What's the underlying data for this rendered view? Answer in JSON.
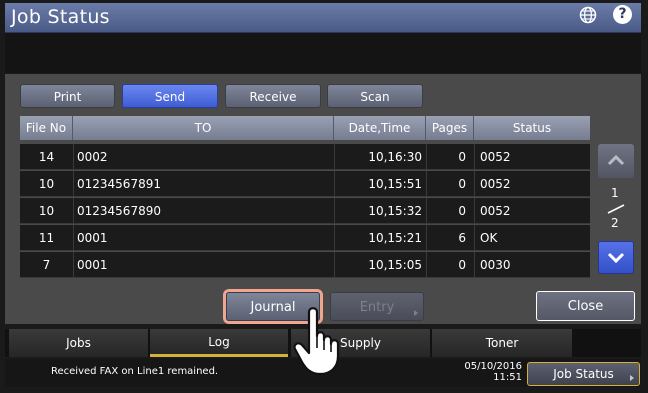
{
  "app": {
    "title": "Job Status"
  },
  "header": {
    "globe_icon": "globe-icon",
    "help_icon": "help-icon",
    "help_glyph": "?"
  },
  "tabs": [
    {
      "label": "Print",
      "active": false
    },
    {
      "label": "Send",
      "active": true
    },
    {
      "label": "Receive",
      "active": false
    },
    {
      "label": "Scan",
      "active": false
    }
  ],
  "table": {
    "columns": [
      "File No",
      "TO",
      "Date,Time",
      "Pages",
      "Status"
    ],
    "rows": [
      {
        "file_no": "14",
        "to": "0002",
        "datetime": "10,16:30",
        "pages": "0",
        "status": "0052"
      },
      {
        "file_no": "10",
        "to": "01234567891",
        "datetime": "10,15:51",
        "pages": "0",
        "status": "0052"
      },
      {
        "file_no": "10",
        "to": "01234567890",
        "datetime": "10,15:32",
        "pages": "0",
        "status": "0052"
      },
      {
        "file_no": "11",
        "to": "0001",
        "datetime": "10,15:21",
        "pages": "6",
        "status": "OK"
      },
      {
        "file_no": "7",
        "to": "0001",
        "datetime": "10,15:05",
        "pages": "0",
        "status": "0030"
      }
    ]
  },
  "pagination": {
    "current": "1",
    "total": "2"
  },
  "actions": {
    "journal": "Journal",
    "entry": "Entry",
    "close": "Close"
  },
  "bottom_tabs": [
    {
      "label": "Jobs",
      "active": false
    },
    {
      "label": "Log",
      "active": true
    },
    {
      "label": "Supply",
      "active": false
    },
    {
      "label": "Toner",
      "active": false
    }
  ],
  "status": {
    "message": "Received FAX on Line1 remained.",
    "date": "05/10/2016",
    "time": "11:51",
    "job_status_button": "Job Status"
  },
  "colors": {
    "accent_active": "#4a68e0",
    "highlight_ring": "#f0a58e",
    "log_underline": "#d4b13a"
  }
}
